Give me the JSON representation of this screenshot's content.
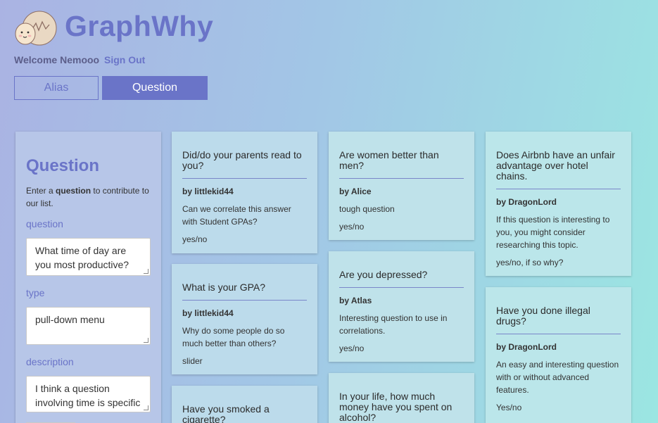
{
  "header": {
    "brand": "GraphWhy",
    "welcome_text": "Welcome Nemooo",
    "sign_out": "Sign Out"
  },
  "tabs": [
    {
      "label": "Alias"
    },
    {
      "label": "Question"
    }
  ],
  "form": {
    "title": "Question",
    "intro_prefix": "Enter a ",
    "intro_bold": "question",
    "intro_suffix": " to contribute to our list.",
    "question_label": "question",
    "question_value": "What time of day are you most productive?",
    "type_label": "type",
    "type_value": "pull-down menu",
    "description_label": "description",
    "description_value": "I think a question involving time is specific enough to be quite"
  },
  "cards": [
    {
      "title": "Did/do your parents read to you?",
      "author": "by littlekid44",
      "description": "Can we correlate this answer with Student GPAs?",
      "type": "yes/no"
    },
    {
      "title": "What is your GPA?",
      "author": "by littlekid44",
      "description": "Why do some people do so much better than others?",
      "type": "slider"
    },
    {
      "title": "Have you smoked a cigarette?",
      "author": "",
      "description": "",
      "type": ""
    },
    {
      "title": "Are women better than men?",
      "author": "by Alice",
      "description": "tough question",
      "type": "yes/no"
    },
    {
      "title": "Are you depressed?",
      "author": "by Atlas",
      "description": "Interesting question to use in correlations.",
      "type": "yes/no"
    },
    {
      "title": "In your life, how much money have you spent on alcohol?",
      "author": "",
      "description": "",
      "type": ""
    },
    {
      "title": "Does Airbnb have an unfair advantage over hotel chains.",
      "author": "by DragonLord",
      "description": "If this question is interesting to you, you might consider researching this topic.",
      "type": "yes/no, if so why?"
    },
    {
      "title": "Have you done illegal drugs?",
      "author": "by DragonLord",
      "description": "An easy and interesting question with or without advanced features.",
      "type": "Yes/no"
    }
  ]
}
